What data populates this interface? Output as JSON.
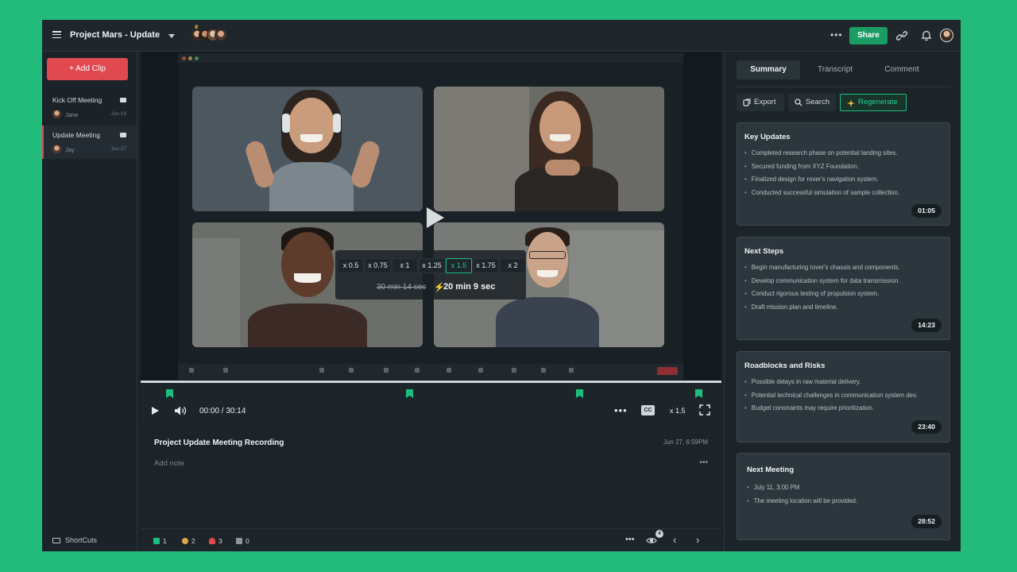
{
  "header": {
    "title": "Project Mars - Update",
    "share_label": "Share"
  },
  "sidebar": {
    "add_clip_label": "Add Clip",
    "clips": [
      {
        "title": "Kick Off Meeting",
        "user": "Jane",
        "date": "Jun 19"
      },
      {
        "title": "Update Meeting",
        "user": "Jay",
        "date": "Jun 27"
      }
    ],
    "shortcuts_label": "ShortCuts"
  },
  "video": {
    "speed_options": [
      "x 0.5",
      "x 0.75",
      "x 1",
      "x 1.25",
      "x 1.5",
      "x 1.75",
      "x 2"
    ],
    "selected_speed": "x 1.5",
    "original_duration": "30 min 14 sec",
    "new_duration": "20 min 9 sec"
  },
  "controls": {
    "time": "00:00 / 30:14",
    "cc_label": "CC",
    "speed": "x 1.5"
  },
  "note": {
    "recording_title": "Project Update Meeting Recording",
    "recording_date": "Jun 27, 6:59PM",
    "add_note_placeholder": "Add note"
  },
  "stats": {
    "bookmarks": "1",
    "claps": "2",
    "likes": "3",
    "comments": "0",
    "viewers": "4"
  },
  "panel": {
    "tabs": [
      "Summary",
      "Transcript",
      "Comment"
    ],
    "export_label": "Export",
    "search_label": "Search",
    "regenerate_label": "Regenerate",
    "cards": [
      {
        "title": "Key Updates",
        "items": [
          "Completed research phase on potential landing sites.",
          "Secured funding from XYZ Foundation.",
          "Finalized design for rover's navigation system.",
          "Conducted successful simulation of sample collection."
        ],
        "timestamp": "01:05"
      },
      {
        "title": "Next Steps",
        "items": [
          "Begin manufacturing rover's chassis and components.",
          "Develop communication system for data transmission.",
          "Conduct rigorous testing of propulsion system.",
          "Draft mission plan and timeline."
        ],
        "timestamp": "14:23"
      },
      {
        "title": "Roadblocks and Risks",
        "items": [
          "Possible delays in raw material delivery.",
          "Potential technical challenges in communication system dev.",
          "Budget constraints may require prioritization."
        ],
        "timestamp": "23:40"
      },
      {
        "title": "Next Meeting",
        "items": [
          "July 11, 3:00 PM",
          "The meeting location will be provided."
        ],
        "timestamp": "28:52"
      }
    ]
  },
  "colors": {
    "background_green": "#22bb7b",
    "accent_green": "#1a9c63",
    "add_clip_red": "#e04950"
  }
}
